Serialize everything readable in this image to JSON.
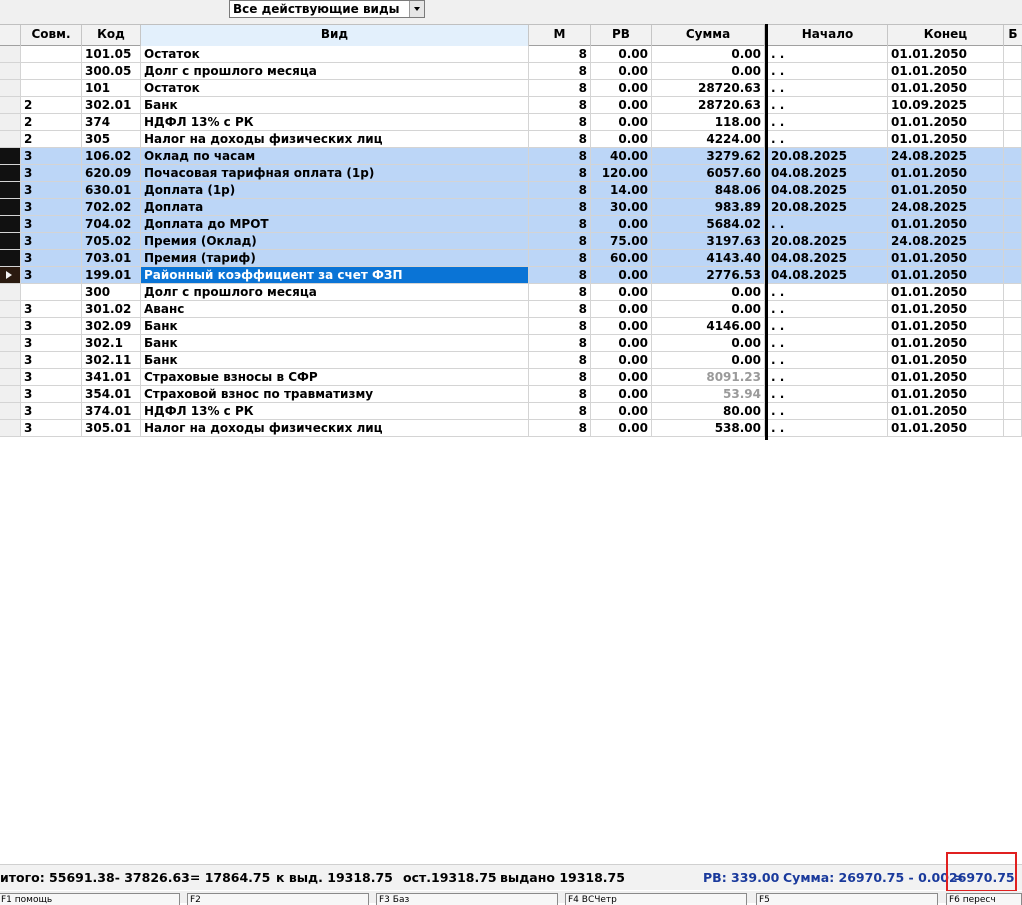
{
  "filter": {
    "value": "Все действующие виды"
  },
  "columns": {
    "sovm": "Совм.",
    "kod": "Код",
    "vid": "Вид",
    "m": "М",
    "rv": "РВ",
    "summa": "Сумма",
    "nachalo": "Начало",
    "konec": "Конец",
    "extra": "Б"
  },
  "rows": [
    {
      "sovm": "",
      "kod": "101.05",
      "vid": "Остаток",
      "m": "8",
      "rv": "0.00",
      "summa": "0.00",
      "nachalo": ". .",
      "konec": "01.01.2050"
    },
    {
      "sovm": "",
      "kod": "300.05",
      "vid": "Долг с прошлого месяца",
      "m": "8",
      "rv": "0.00",
      "summa": "0.00",
      "nachalo": ". .",
      "konec": "01.01.2050"
    },
    {
      "sovm": "",
      "kod": "101",
      "vid": "Остаток",
      "m": "8",
      "rv": "0.00",
      "summa": "28720.63",
      "nachalo": ". .",
      "konec": "01.01.2050"
    },
    {
      "sovm": "2",
      "kod": "302.01",
      "vid": "Банк",
      "m": "8",
      "rv": "0.00",
      "summa": "28720.63",
      "nachalo": ". .",
      "konec": "10.09.2025"
    },
    {
      "sovm": "2",
      "kod": "374",
      "vid": "НДФЛ 13% с РК",
      "m": "8",
      "rv": "0.00",
      "summa": "118.00",
      "nachalo": ". .",
      "konec": "01.01.2050"
    },
    {
      "sovm": "2",
      "kod": "305",
      "vid": "Налог на доходы физических лиц",
      "m": "8",
      "rv": "0.00",
      "summa": "4224.00",
      "nachalo": ". .",
      "konec": "01.01.2050"
    },
    {
      "sovm": "3",
      "kod": "106.02",
      "vid": "Оклад по часам",
      "m": "8",
      "rv": "40.00",
      "summa": "3279.62",
      "nachalo": "20.08.2025",
      "konec": "24.08.2025",
      "sel": true
    },
    {
      "sovm": "3",
      "kod": "620.09",
      "vid": "Почасовая тарифная оплата (1р)",
      "m": "8",
      "rv": "120.00",
      "summa": "6057.60",
      "nachalo": "04.08.2025",
      "konec": "01.01.2050",
      "sel": true
    },
    {
      "sovm": "3",
      "kod": "630.01",
      "vid": "Доплата (1р)",
      "m": "8",
      "rv": "14.00",
      "summa": "848.06",
      "nachalo": "04.08.2025",
      "konec": "01.01.2050",
      "sel": true
    },
    {
      "sovm": "3",
      "kod": "702.02",
      "vid": "Доплата",
      "m": "8",
      "rv": "30.00",
      "summa": "983.89",
      "nachalo": "20.08.2025",
      "konec": "24.08.2025",
      "sel": true
    },
    {
      "sovm": "3",
      "kod": "704.02",
      "vid": "Доплата до МРОТ",
      "m": "8",
      "rv": "0.00",
      "summa": "5684.02",
      "nachalo": ". .",
      "konec": "01.01.2050",
      "sel": true
    },
    {
      "sovm": "3",
      "kod": "705.02",
      "vid": "Премия (Оклад)",
      "m": "8",
      "rv": "75.00",
      "summa": "3197.63",
      "nachalo": "20.08.2025",
      "konec": "24.08.2025",
      "sel": true
    },
    {
      "sovm": "3",
      "kod": "703.01",
      "vid": "Премия (тариф)",
      "m": "8",
      "rv": "60.00",
      "summa": "4143.40",
      "nachalo": "04.08.2025",
      "konec": "01.01.2050",
      "sel": true
    },
    {
      "sovm": "3",
      "kod": "199.01",
      "vid": "Районный коэффициент за счет ФЗП",
      "m": "8",
      "rv": "0.00",
      "summa": "2776.53",
      "nachalo": "04.08.2025",
      "konec": "01.01.2050",
      "sel": true,
      "cur": true
    },
    {
      "sovm": "",
      "kod": "300",
      "vid": "Долг с прошлого месяца",
      "m": "8",
      "rv": "0.00",
      "summa": "0.00",
      "nachalo": ". .",
      "konec": "01.01.2050"
    },
    {
      "sovm": "3",
      "kod": "301.02",
      "vid": "Аванс",
      "m": "8",
      "rv": "0.00",
      "summa": "0.00",
      "nachalo": ". .",
      "konec": "01.01.2050"
    },
    {
      "sovm": "3",
      "kod": "302.09",
      "vid": "Банк",
      "m": "8",
      "rv": "0.00",
      "summa": "4146.00",
      "nachalo": ". .",
      "konec": "01.01.2050"
    },
    {
      "sovm": "3",
      "kod": "302.1",
      "vid": "Банк",
      "m": "8",
      "rv": "0.00",
      "summa": "0.00",
      "nachalo": ". .",
      "konec": "01.01.2050"
    },
    {
      "sovm": "3",
      "kod": "302.11",
      "vid": "Банк",
      "m": "8",
      "rv": "0.00",
      "summa": "0.00",
      "nachalo": ". .",
      "konec": "01.01.2050"
    },
    {
      "sovm": "3",
      "kod": "341.01",
      "vid": "Страховые взносы в СФР",
      "m": "8",
      "rv": "0.00",
      "summa": "8091.23",
      "nachalo": ". .",
      "konec": "01.01.2050",
      "dim": true
    },
    {
      "sovm": "3",
      "kod": "354.01",
      "vid": "Страховой взнос по травматизму",
      "m": "8",
      "rv": "0.00",
      "summa": "53.94",
      "nachalo": ". .",
      "konec": "01.01.2050",
      "dim": true
    },
    {
      "sovm": "3",
      "kod": "374.01",
      "vid": "НДФЛ 13% с РК",
      "m": "8",
      "rv": "0.00",
      "summa": "80.00",
      "nachalo": ". .",
      "konec": "01.01.2050"
    },
    {
      "sovm": "3",
      "kod": "305.01",
      "vid": "Налог на доходы физических лиц",
      "m": "8",
      "rv": "0.00",
      "summa": "538.00",
      "nachalo": ". .",
      "konec": "01.01.2050"
    }
  ],
  "footer": {
    "itogo": "итого: 55691.38- 37826.63= 17864.75",
    "k_vyd": "к выд. 19318.75",
    "ost": "ост.19318.75",
    "vydano": "выдано 19318.75",
    "rv_sum": "РВ: 339.00",
    "summa_expr": "Сумма: 26970.75 - 0.00 =",
    "summa_total": "26970.75"
  },
  "fkeys": [
    "F1 помощь",
    "F2",
    "F3 Баз",
    "F4 ВСЧетр",
    "F5",
    "F6 пересч"
  ],
  "colors": {
    "selected_row": "#bcd6f7",
    "current_cell": "#0a74d6",
    "footer_blue": "#1a3a9c",
    "highlight": "#e02020"
  }
}
